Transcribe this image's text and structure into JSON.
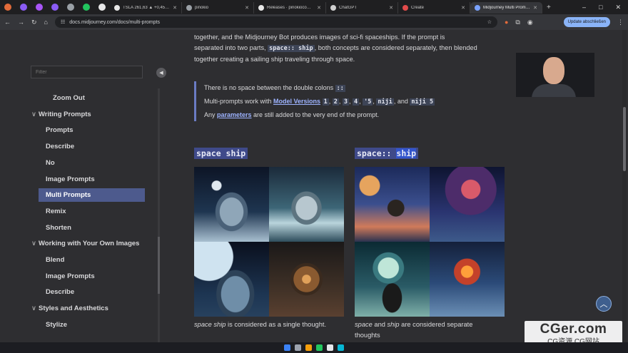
{
  "browser": {
    "tabs": [
      {
        "title": "TSLA 261,63 ▲ +0,45% N",
        "fav": "#e8e8e8"
      },
      {
        "title": "pinokio",
        "fav": "#9aa0a6"
      },
      {
        "title": "Releases · pinokiocomputer",
        "fav": "#e8e8e8"
      },
      {
        "title": "ChatGPT",
        "fav": "#cfcfcf"
      },
      {
        "title": "Create",
        "fav": "#e24b4b"
      },
      {
        "title": "Midjourney Multi Prompts",
        "fav": "#7aa2ff"
      }
    ],
    "pinned_colors": [
      "#e26b3a",
      "#8b5cf6",
      "#a855f7",
      "#8b5cf6",
      "#9aa0a6",
      "#22c55e",
      "#e8e8e8"
    ],
    "url": "docs.midjourney.com/docs/multi-prompts",
    "update_label": "Update abschließen",
    "new_tab": "+",
    "controls": {
      "minimize": "–",
      "maximize": "□",
      "close": "✕"
    }
  },
  "sidebar": {
    "filter_placeholder": "Filter",
    "collapse_icon": "◀",
    "items": [
      {
        "label": "Zoom Out",
        "level": "sub",
        "indent": "wide"
      },
      {
        "label": "Writing Prompts",
        "level": "section"
      },
      {
        "label": "Prompts",
        "level": "sub"
      },
      {
        "label": "Describe",
        "level": "sub"
      },
      {
        "label": "No",
        "level": "sub"
      },
      {
        "label": "Image Prompts",
        "level": "sub"
      },
      {
        "label": "Multi Prompts",
        "level": "sub",
        "active": true
      },
      {
        "label": "Remix",
        "level": "sub"
      },
      {
        "label": "Shorten",
        "level": "sub"
      },
      {
        "label": "Working with Your Own Images",
        "level": "section"
      },
      {
        "label": "Blend",
        "level": "sub"
      },
      {
        "label": "Image Prompts",
        "level": "sub"
      },
      {
        "label": "Describe",
        "level": "sub"
      },
      {
        "label": "Styles and Aesthetics",
        "level": "section"
      },
      {
        "label": "Stylize",
        "level": "sub"
      }
    ]
  },
  "content": {
    "para_1": "together, and the Midjourney Bot produces images of sci-fi spaceships. If the prompt is",
    "para_2a": "separated into two parts, ",
    "para_2_code": "space:: ship",
    "para_2b": ", both concepts are considered separately, then blended",
    "para_3": "together creating a sailing ship traveling through space.",
    "note_1": "There is no space between the double colons ",
    "note_1_code": "::",
    "note_2a": "Multi-prompts work with ",
    "note_2_link": "Model Versions",
    "note_2_codes": [
      "1",
      "2",
      "3",
      "4",
      "'5",
      "niji"
    ],
    "note_2_and": ", and ",
    "note_2_last": "niji 5",
    "note_3a": "Any ",
    "note_3_link": "parameters",
    "note_3b": " are still added to the very end of the prompt.",
    "left_label": "space ship",
    "right_label_a": "space:: ",
    "right_label_b": "ship",
    "left_caption_em": "space ship",
    "left_caption_rest": " is considered as a single thought.",
    "right_caption_em1": "space",
    "right_caption_mid": " and ",
    "right_caption_em2": "ship",
    "right_caption_rest": " are considered separate",
    "right_caption_line2": "thoughts"
  },
  "scroll_top_icon": "︿",
  "watermark": {
    "big": "CGer.com",
    "small": "CG资源 CG网站"
  }
}
